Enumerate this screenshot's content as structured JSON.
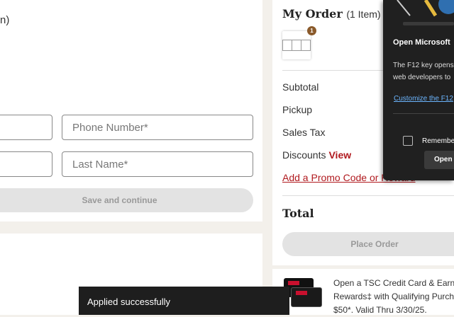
{
  "form": {
    "fragment_text": "n)",
    "phone_placeholder": "Phone Number*",
    "last_name_placeholder": "Last Name*",
    "save_label": "Save and continue"
  },
  "order": {
    "title": "My Order",
    "count": "(1 Item)",
    "item_quantity": "1",
    "subtotal_label": "Subtotal",
    "pickup_label": "Pickup",
    "tax_label": "Sales Tax",
    "discounts_label": "Discounts",
    "view_label": "View",
    "promo_label": "Add a Promo Code or Reward",
    "total_label": "Total",
    "place_order_label": "Place Order"
  },
  "credit_promo": {
    "line1": "Open a TSC Credit Card & Earn",
    "line2": "Rewards‡ with Qualifying Purch",
    "line3": "$50*. Valid Thru 3/30/25."
  },
  "toast": {
    "message": "Applied successfully"
  },
  "devtools": {
    "title": "Open Microsoft",
    "desc1": "The F12 key opens",
    "desc2": "web developers to",
    "link": "Customize the F12",
    "remember": "Remember",
    "open_label": "Open"
  },
  "colors": {
    "accent_red": "#b0191e",
    "toast_bg": "#1e1e1e",
    "devtools_bg": "#202020",
    "badge_brown": "#8a5a2b"
  }
}
